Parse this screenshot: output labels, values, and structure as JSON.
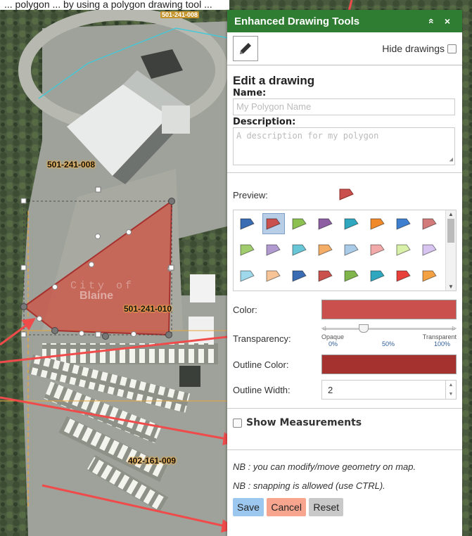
{
  "caption": "... polygon ... by using a polygon drawing tool ...",
  "map": {
    "parcels": [
      "501-241-008",
      "501-241-008",
      "501-241-010",
      "402-161-009"
    ],
    "city_text_1": "City of",
    "city_text_2": "Blaine"
  },
  "panel": {
    "title": "Enhanced Drawing Tools",
    "collapse_icon": "«",
    "close_icon": "×",
    "hide_drawings_label": "Hide drawings",
    "edit_title": "Edit a drawing",
    "name_label": "Name:",
    "name_placeholder": "My Polygon Name",
    "description_label": "Description:",
    "description_placeholder": "A description for my polygon",
    "preview_label": "Preview:",
    "color_label": "Color:",
    "color_value": "#c9504d",
    "transparency_label": "Transparency:",
    "transparency_left": "Opaque",
    "transparency_right": "Transparent",
    "tick_labels": [
      "0%",
      "50%",
      "100%"
    ],
    "transparency_value": 0.3,
    "outline_color_label": "Outline Color:",
    "outline_color_value": "#a6322f",
    "outline_width_label": "Outline Width:",
    "outline_width_value": "2",
    "show_measurements_label": "Show Measurements",
    "nb1": "NB : you can modify/move geometry on map.",
    "nb2": "NB : snapping is allowed (use CTRL).",
    "save_label": "Save",
    "cancel_label": "Cancel",
    "reset_label": "Reset",
    "symbol_colors": [
      "#3a6cb3",
      "#c9504d",
      "#8cc152",
      "#8e5ea2",
      "#2fa8bf",
      "#f0892a",
      "#3f7fcf",
      "#d37a7a",
      "#a0cc6e",
      "#b09ad0",
      "#68c6d6",
      "#f4ad66",
      "#a9cbe8",
      "#f2a9a9",
      "#d8f0a8",
      "#d8c4f0",
      "#9ed8ea",
      "#f7c497",
      "#3a6cb3",
      "#c9504d",
      "#7fb54a",
      "#2fa8bf",
      "#e8413c",
      "#f4a144"
    ]
  }
}
